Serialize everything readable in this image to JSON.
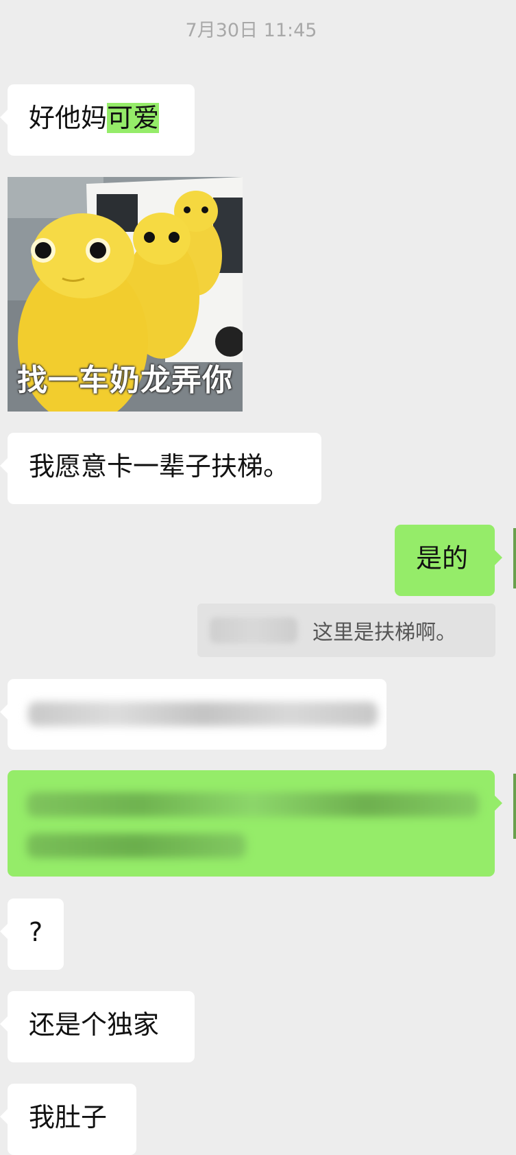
{
  "timestamp": "7月30日 11:45",
  "messages": [
    {
      "text_plain": "好他妈",
      "text_highlight": "可爱"
    },
    {
      "sticker_caption": "找一车奶龙弄你"
    },
    {
      "text": "我愿意卡一辈子扶梯。"
    },
    {
      "text": "是的"
    },
    {
      "quote_text": "这里是扶梯啊。"
    },
    {
      "text": "?"
    },
    {
      "text": "还是个独家"
    },
    {
      "text": "我肚子"
    }
  ],
  "colors": {
    "background": "#ededed",
    "incoming_bubble": "#ffffff",
    "outgoing_bubble": "#95ec69",
    "quote_box": "#e2e2e2",
    "timestamp": "#a8a8a8"
  }
}
